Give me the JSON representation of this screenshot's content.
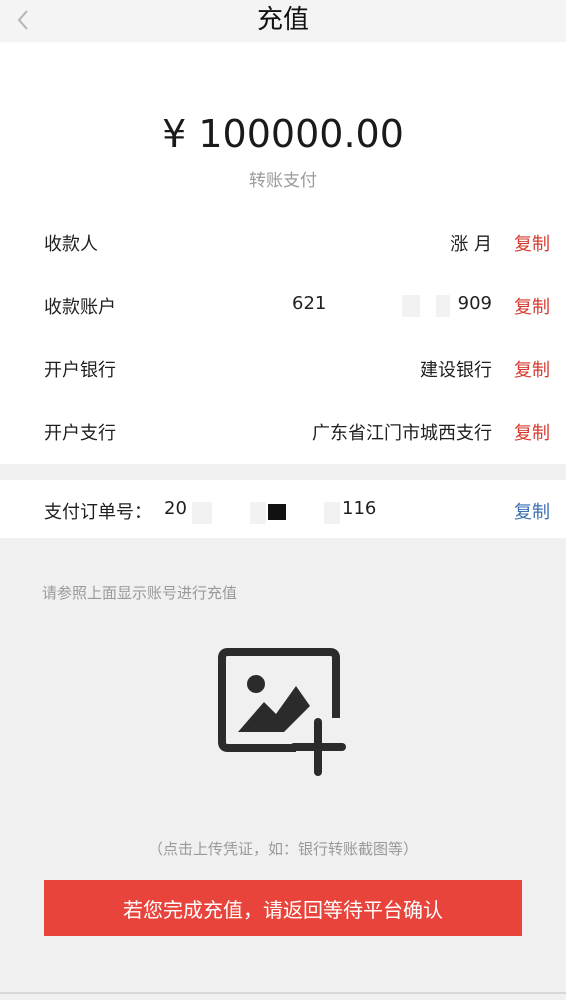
{
  "header": {
    "title": "充值",
    "back_icon": "chevron-left-icon"
  },
  "payment": {
    "amount": "¥ 100000.00",
    "method": "转账支付"
  },
  "rows": [
    {
      "label": "收款人",
      "value": "涨 月",
      "copy": "复制"
    },
    {
      "label": "收款账户",
      "value_prefix": "621",
      "value_suffix": "909",
      "copy": "复制"
    },
    {
      "label": "开户银行",
      "value": "建设银行",
      "copy": "复制"
    },
    {
      "label": "开户支行",
      "value": "广东省江门市城西支行",
      "copy": "复制"
    }
  ],
  "order": {
    "label": "支付订单号：",
    "value_prefix": "20",
    "value_suffix": "116",
    "copy": "复制"
  },
  "hint": "请参照上面显示账号进行充值",
  "upload": {
    "icon": "add-image-icon",
    "caption": "（点击上传凭证，如：银行转账截图等）"
  },
  "confirm_button": "若您完成充值，请返回等待平台确认",
  "colors": {
    "accent_red": "#e8443c",
    "copy_red": "#d63a2f",
    "copy_blue": "#3a6fb0"
  }
}
